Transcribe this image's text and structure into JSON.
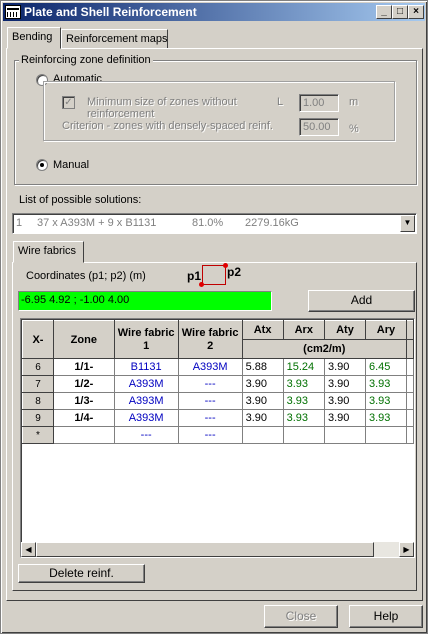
{
  "window": {
    "title": "Plate and Shell Reinforcement"
  },
  "tabs": [
    {
      "label": "Bending"
    },
    {
      "label": "Reinforcement maps"
    }
  ],
  "zone_def": {
    "legend": "Reinforcing zone definition",
    "automatic_label": "Automatic",
    "min_size_label_1": "Minimum size of zones without",
    "min_size_label_2": "reinforcement",
    "criterion_label": "Criterion - zones with densely-spaced reinf.",
    "l_label": "L",
    "l_value": "1.00",
    "l_unit": "m",
    "criterion_value": "50.00",
    "criterion_unit": "%",
    "manual_label": "Manual",
    "selected": "manual"
  },
  "solutions": {
    "label": "List of possible solutions:",
    "selected": {
      "index": "1",
      "description": "37 x A393M + 9 x B1131",
      "percent": "81.0%",
      "weight": "2279.16kG"
    }
  },
  "wire_tab": {
    "label": "Wire fabrics"
  },
  "coords": {
    "label": "Coordinates (p1; p2) (m)",
    "p1": "p1",
    "p2": "p2",
    "value": "-6.95  4.92  ;  -1.00  4.00",
    "add_label": "Add"
  },
  "table": {
    "headers": {
      "x": "X-",
      "zone": "Zone",
      "wf1_a": "Wire fabric",
      "wf1_b": "1",
      "wf2_a": "Wire fabric",
      "wf2_b": "2",
      "atx": "Atx",
      "arx": "Arx",
      "aty": "Aty",
      "ary": "Ary",
      "unit": "(cm2/m)"
    },
    "rows": [
      {
        "num": "6",
        "zone": "1/1-",
        "wf1": "B1131",
        "wf2": "A393M",
        "atx": "5.88",
        "arx": "15.24",
        "aty": "3.90",
        "ary": "6.45"
      },
      {
        "num": "7",
        "zone": "1/2-",
        "wf1": "A393M",
        "wf2": "---",
        "atx": "3.90",
        "arx": "3.93",
        "aty": "3.90",
        "ary": "3.93"
      },
      {
        "num": "8",
        "zone": "1/3-",
        "wf1": "A393M",
        "wf2": "---",
        "atx": "3.90",
        "arx": "3.93",
        "aty": "3.90",
        "ary": "3.93"
      },
      {
        "num": "9",
        "zone": "1/4-",
        "wf1": "A393M",
        "wf2": "---",
        "atx": "3.90",
        "arx": "3.93",
        "aty": "3.90",
        "ary": "3.93"
      },
      {
        "num": "*",
        "zone": "",
        "wf1": "---",
        "wf2": "---",
        "atx": "",
        "arx": "",
        "aty": "",
        "ary": ""
      }
    ]
  },
  "buttons": {
    "delete_label": "Delete reinf.",
    "close_label": "Close",
    "help_label": "Help"
  },
  "colors": {
    "coords_bg": "#00ff00",
    "titlebar": "#0a246a",
    "blue_text": "#0000c0",
    "green_text": "#007000"
  }
}
